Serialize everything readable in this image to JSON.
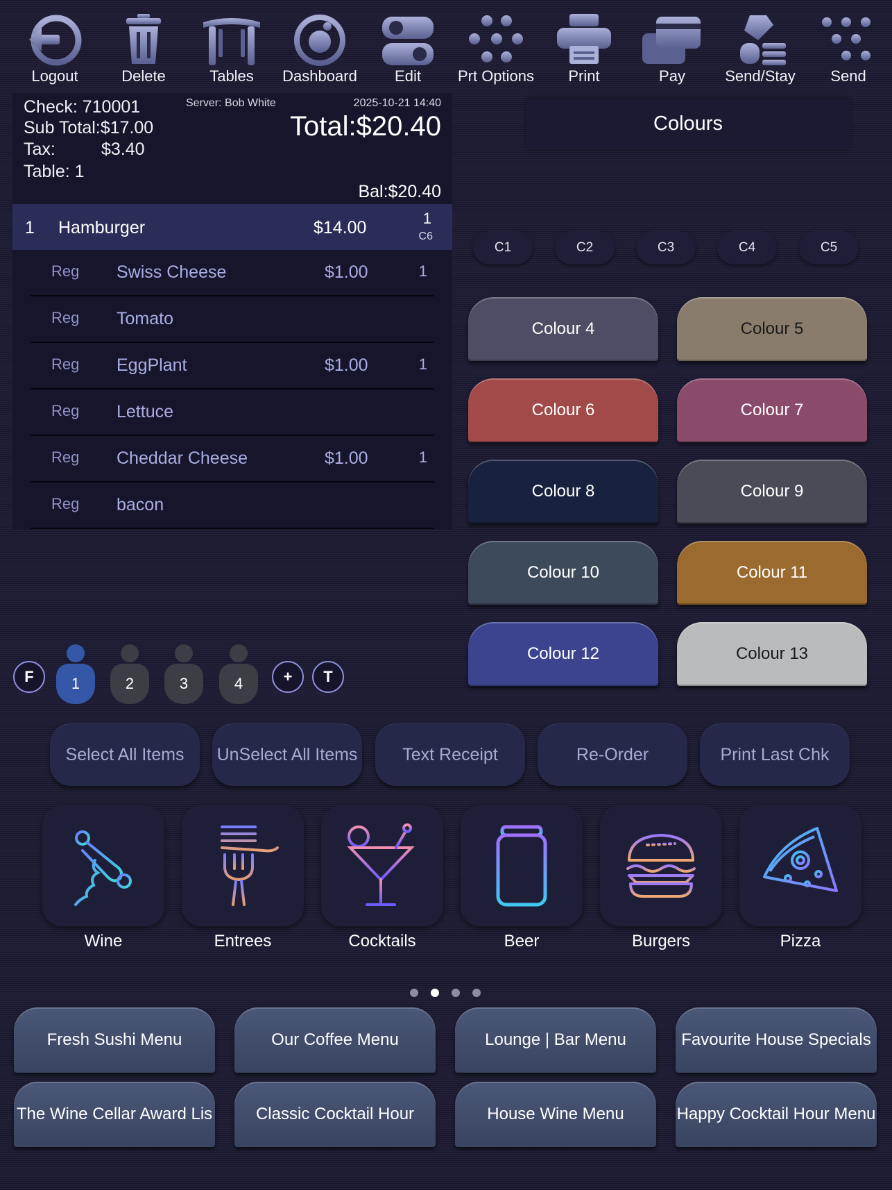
{
  "toolbar": {
    "buttons": [
      {
        "label": "Logout",
        "icon": "logout-icon"
      },
      {
        "label": "Delete",
        "icon": "trash-icon"
      },
      {
        "label": "Tables",
        "icon": "table-icon"
      },
      {
        "label": "Dashboard",
        "icon": "dashboard-icon"
      },
      {
        "label": "Edit",
        "icon": "edit-icon"
      },
      {
        "label": "Prt Options",
        "icon": "printer-options-icon"
      },
      {
        "label": "Print",
        "icon": "printer-icon"
      },
      {
        "label": "Pay",
        "icon": "card-icon"
      },
      {
        "label": "Send/Stay",
        "icon": "send-stay-icon"
      },
      {
        "label": "Send",
        "icon": "send-icon"
      }
    ]
  },
  "check": {
    "check_line": "Check: 710001",
    "subtotal_line": "Sub Total:$17.00",
    "tax_label": "Tax:",
    "tax_value": "$3.40",
    "table_line": "Table: 1",
    "server": "Server: Bob White",
    "datetime": "2025-10-21 14:40",
    "total": "Total:$20.40",
    "balance": "Bal:$20.40"
  },
  "order": {
    "main_item": {
      "qty": "1",
      "name": "Hamburger",
      "price": "$14.00",
      "count": "1",
      "seat_code": "C6"
    },
    "modifiers": [
      {
        "type": "Reg",
        "name": "Swiss Cheese",
        "price": "$1.00",
        "qty": "1"
      },
      {
        "type": "Reg",
        "name": "Tomato",
        "price": "",
        "qty": ""
      },
      {
        "type": "Reg",
        "name": "EggPlant",
        "price": "$1.00",
        "qty": "1"
      },
      {
        "type": "Reg",
        "name": "Lettuce",
        "price": "",
        "qty": ""
      },
      {
        "type": "Reg",
        "name": "Cheddar Cheese",
        "price": "$1.00",
        "qty": "1"
      },
      {
        "type": "Reg",
        "name": "bacon",
        "price": "",
        "qty": ""
      }
    ]
  },
  "colours_panel": {
    "title": "Colours",
    "tabs": [
      "C1",
      "C2",
      "C3",
      "C4",
      "C5"
    ],
    "buttons": [
      {
        "label": "Colour 4",
        "color": "#4d4e66"
      },
      {
        "label": "Colour 5",
        "color": "#8a7c6c",
        "text_color": "#1a1a1a"
      },
      {
        "label": "Colour 6",
        "color": "#a24a4a"
      },
      {
        "label": "Colour 7",
        "color": "#8a4b6a"
      },
      {
        "label": "Colour 8",
        "color": "#18223f"
      },
      {
        "label": "Colour 9",
        "color": "#4a4b56"
      },
      {
        "label": "Colour 10",
        "color": "#3d4a5c"
      },
      {
        "label": "Colour 11",
        "color": "#9a6a2e"
      },
      {
        "label": "Colour 12",
        "color": "#3c4490"
      },
      {
        "label": "Colour 13",
        "color": "#b9bcbd",
        "text_color": "#1a1a1a"
      }
    ]
  },
  "seats": {
    "left_icon": "F",
    "items": [
      "1",
      "2",
      "3",
      "4"
    ],
    "active_seat": "1",
    "add_icon": "+",
    "right_icon": "T",
    "active_color": "#3557a8",
    "inactive_color": "#3c3d45"
  },
  "actions": [
    "Select All Items",
    "UnSelect All Items",
    "Text Receipt",
    "Re-Order",
    "Print Last Chk"
  ],
  "categories": [
    {
      "label": "Wine",
      "icon": "corkscrew-icon"
    },
    {
      "label": "Entrees",
      "icon": "fork-icon"
    },
    {
      "label": "Cocktails",
      "icon": "cocktail-icon"
    },
    {
      "label": "Beer",
      "icon": "beer-can-icon"
    },
    {
      "label": "Burgers",
      "icon": "burger-icon"
    },
    {
      "label": "Pizza",
      "icon": "pizza-icon"
    }
  ],
  "pager": {
    "count": 4,
    "active": 2
  },
  "menus": [
    "Fresh Sushi Menu",
    "Our Coffee Menu",
    "Lounge | Bar Menu",
    "Favourite House Specials",
    "The Wine Cellar Award Lis",
    "Classic Cocktail Hour",
    "House Wine Menu",
    "Happy Cocktail Hour Menu"
  ]
}
